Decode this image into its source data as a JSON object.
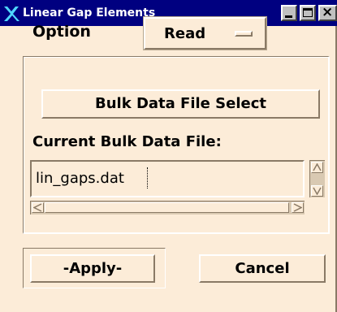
{
  "window": {
    "title": "Linear Gap Elements",
    "accent_color": "#000080",
    "background_color": "#fcecd8",
    "controls": {
      "minimize_icon": "minimize-icon",
      "maximize_icon": "maximize-icon",
      "close_icon": "close-icon",
      "close_glyph": "×"
    },
    "logo_icon": "x-logo-icon"
  },
  "option": {
    "label": "Option",
    "selected_value": "Read"
  },
  "bulk_data": {
    "select_button_label": "Bulk Data File Select",
    "current_file_label": "Current Bulk Data File:",
    "current_file_value": "lin_gaps.dat"
  },
  "actions": {
    "apply_label": "-Apply-",
    "cancel_label": "Cancel"
  }
}
